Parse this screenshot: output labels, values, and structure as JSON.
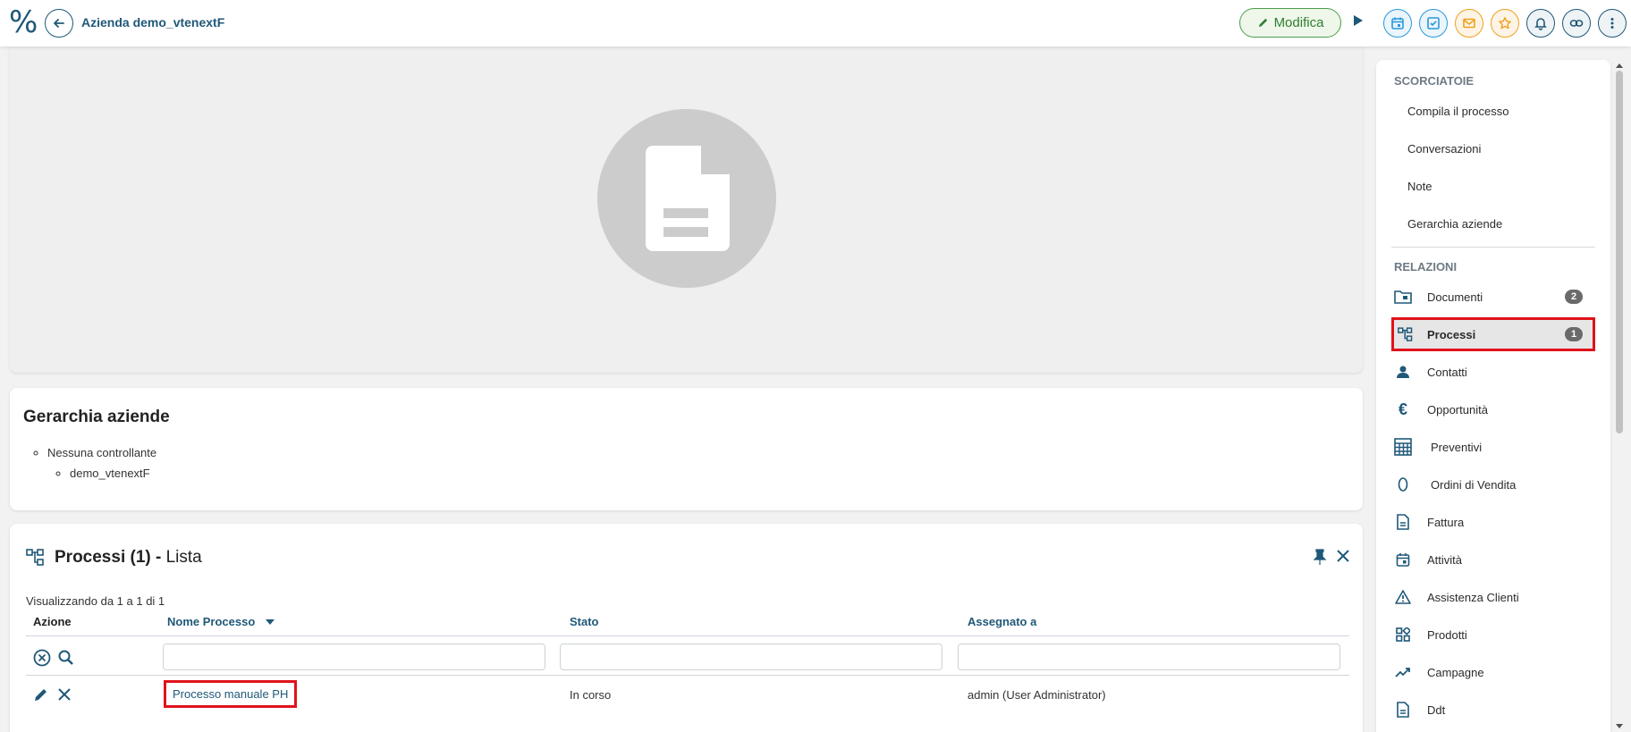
{
  "header": {
    "logo": "%",
    "title": "Azienda demo_vtenextF",
    "modifica_label": "Modifica"
  },
  "hierarchy": {
    "title": "Gerarchia aziende",
    "parent": "Nessuna controllante",
    "child": "demo_vtenextF"
  },
  "processes": {
    "title_bold": "Processi (1) -",
    "title_rest": " Lista",
    "showing": "Visualizzando da 1 a 1 di 1",
    "columns": {
      "action": "Azione",
      "name": "Nome Processo",
      "status": "Stato",
      "assigned": "Assegnato a"
    },
    "rows": [
      {
        "name": "Processo manuale PH",
        "status": "In corso",
        "assigned": "admin (User Administrator)"
      }
    ]
  },
  "sidebar": {
    "shortcuts_title": "SCORCIATOIE",
    "shortcuts": [
      "Compila il processo",
      "Conversazioni",
      "Note",
      "Gerarchia aziende"
    ],
    "relations_title": "RELAZIONI",
    "relations": [
      {
        "label": "Documenti",
        "badge": "2",
        "icon": "folder-icon"
      },
      {
        "label": "Processi",
        "badge": "1",
        "icon": "process-icon"
      },
      {
        "label": "Contatti",
        "icon": "person-icon"
      },
      {
        "label": "Opportunità",
        "icon": "euro-icon"
      },
      {
        "label": "Preventivi",
        "icon": "calculator-icon"
      },
      {
        "label": "Ordini di Vendita",
        "icon": "order-icon"
      },
      {
        "label": "Fattura",
        "icon": "invoice-icon"
      },
      {
        "label": "Attività",
        "icon": "calendar-icon"
      },
      {
        "label": "Assistenza Clienti",
        "icon": "warning-icon"
      },
      {
        "label": "Prodotti",
        "icon": "grid-icon"
      },
      {
        "label": "Campagne",
        "icon": "trend-icon"
      },
      {
        "label": "Ddt",
        "icon": "document-icon"
      }
    ]
  },
  "colors": {
    "brand": "#1f5878",
    "highlight": "#e0121a",
    "edit_green": "#2e7d32"
  }
}
